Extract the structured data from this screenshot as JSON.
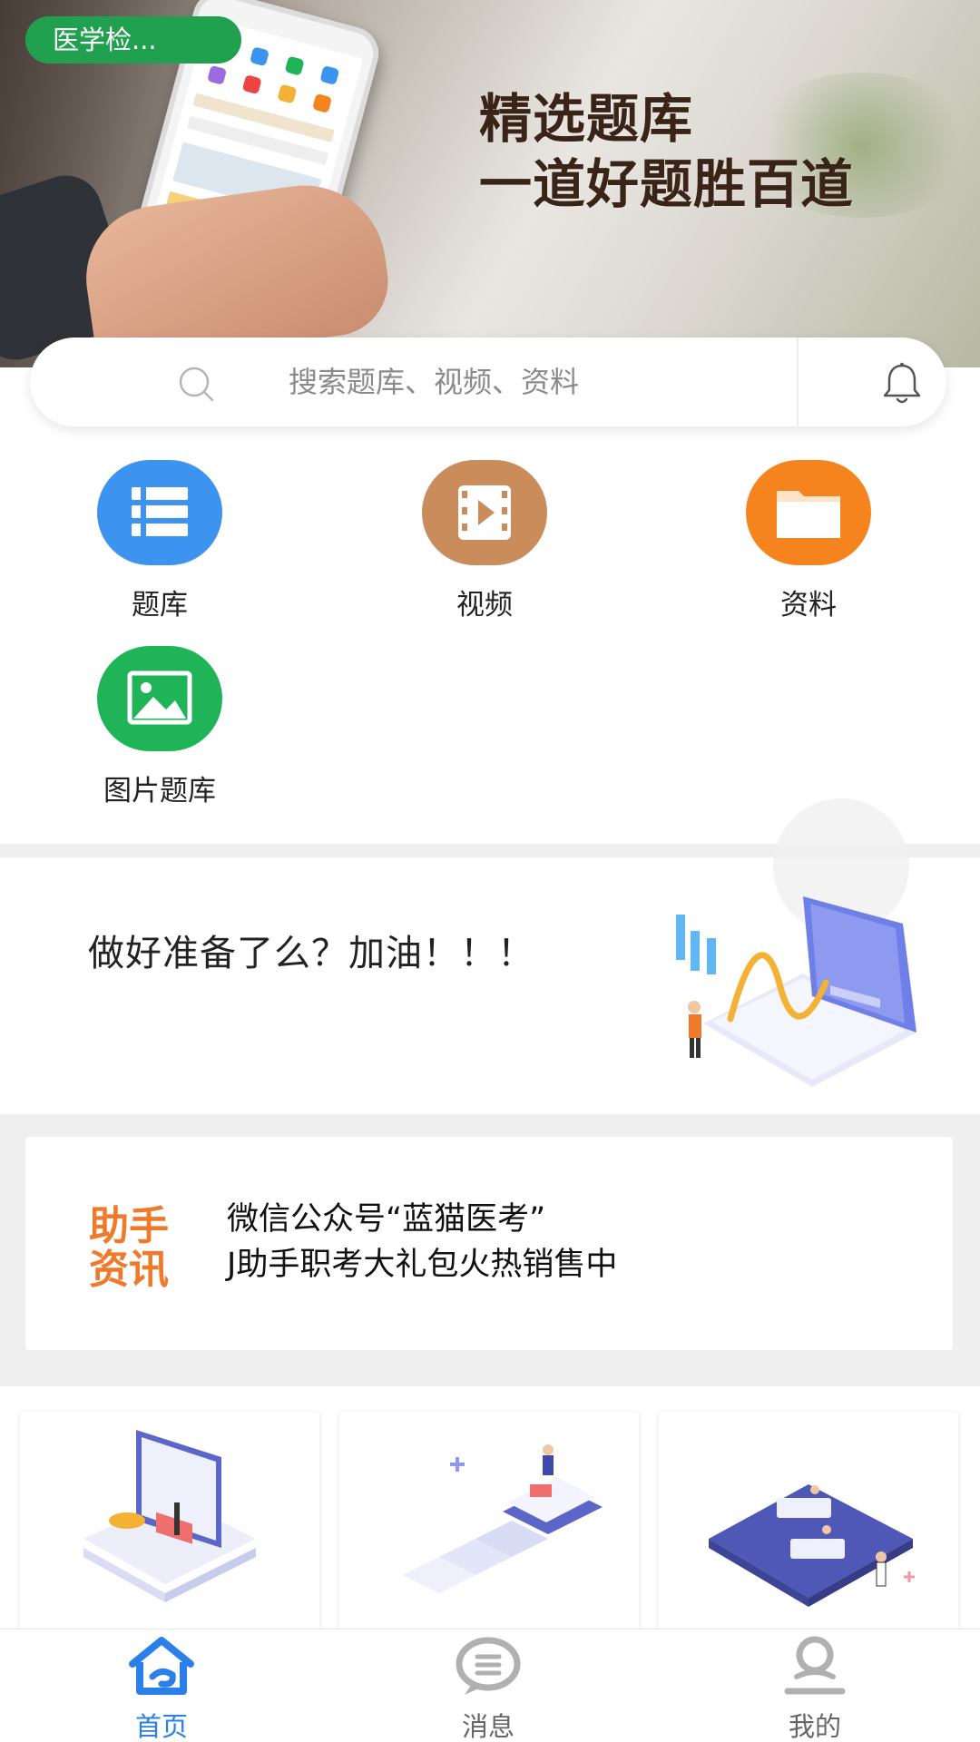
{
  "category": {
    "label": "医学检..."
  },
  "banner": {
    "line1": "精选题库",
    "line2": "一道好题胜百道"
  },
  "search": {
    "placeholder": "搜索题库、视频、资料",
    "search_icon": "search-icon",
    "bell_icon": "bell-icon"
  },
  "quick_links": [
    {
      "label": "题库",
      "icon": "question-bank-icon",
      "color": "#3d94f0"
    },
    {
      "label": "视频",
      "icon": "video-icon",
      "color": "#c98c5a"
    },
    {
      "label": "资料",
      "icon": "folder-icon",
      "color": "#f5841f"
    },
    {
      "label": "图片题库",
      "icon": "image-icon",
      "color": "#20b458"
    }
  ],
  "motivation": {
    "text": "做好准备了么？加油！！！"
  },
  "news": {
    "badge_line1": "助手",
    "badge_line2": "资讯",
    "line1": "微信公众号“蓝猫医考”",
    "line2": "J助手职考大礼包火热销售中"
  },
  "tabs": [
    {
      "label": "首页",
      "icon": "home-icon",
      "active": true
    },
    {
      "label": "消息",
      "icon": "message-icon",
      "active": false
    },
    {
      "label": "我的",
      "icon": "profile-icon",
      "active": false
    }
  ],
  "colors": {
    "accent": "#2a80e8",
    "green": "#21a04f",
    "orange": "#ef7a2b",
    "inactive": "#9a9a9a"
  }
}
